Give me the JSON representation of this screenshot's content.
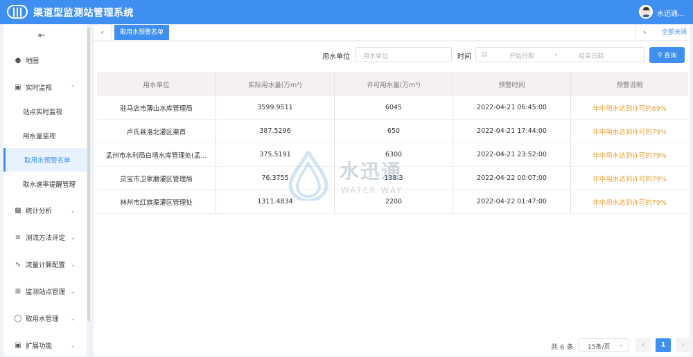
{
  "app": {
    "title": "渠道型监测站管理系统",
    "user_name": "水迅通..."
  },
  "sidebar": {
    "collapse_icon": "menu-fold-icon",
    "items": [
      {
        "label": "地图",
        "icon": "location-icon",
        "expanded": null
      },
      {
        "label": "实时监视",
        "icon": "briefcase-icon",
        "expanded": true
      },
      {
        "label": "统计分析",
        "icon": "bar-chart-icon",
        "expanded": false
      },
      {
        "label": "测流方法评定",
        "icon": "list-icon",
        "expanded": false
      },
      {
        "label": "流量计算配置",
        "icon": "pulse-icon",
        "expanded": false
      },
      {
        "label": "监测站点管理",
        "icon": "grid-icon",
        "expanded": false
      },
      {
        "label": "取用水管理",
        "icon": "drop-icon",
        "expanded": false
      },
      {
        "label": "扩展功能",
        "icon": "expand-icon",
        "expanded": false
      }
    ],
    "subitems": [
      {
        "label": "站点实时监视",
        "active": false
      },
      {
        "label": "用水量监视",
        "active": false
      },
      {
        "label": "取用水预警名单",
        "active": true
      },
      {
        "label": "取水速率提醒管理",
        "active": false
      }
    ]
  },
  "tabs": {
    "active_label": "取用水预警名单",
    "close_all_label": "全部关闭"
  },
  "filters": {
    "unit_label": "用水单位",
    "unit_placeholder": "用水单位",
    "time_label": "时间",
    "start_placeholder": "开始日期",
    "range_separator": "-",
    "end_placeholder": "结束日期",
    "search_label": "查询"
  },
  "table": {
    "headers": [
      "用水单位",
      "实际用水量(万m³)",
      "许可用水量(万m³)",
      "预警时间",
      "预警说明"
    ],
    "rows": [
      [
        "驻马店市薄山水库管理局",
        "3599.9511",
        "6045",
        "2022-04-21 06:45:00",
        "年中用水达到许可的69%"
      ],
      [
        "卢氏县洛北灌区渠首",
        "387.5296",
        "650",
        "2022-04-21 17:44:00",
        "年中用水达到许可的79%"
      ],
      [
        "孟州市水利局白墙水库管理处(孟...",
        "375.5191",
        "6300",
        "2022-04-21 23:52:00",
        "年中用水达到许可的79%"
      ],
      [
        "灵宝市卫家磨灌区管理局",
        "76.3755",
        "138.3",
        "2022-04-22 00:07:00",
        "年中用水达到许可的79%"
      ],
      [
        "林州市红旗渠灌区管理处",
        "1311.4834",
        "2200",
        "2022-04-22 01:47:00",
        "年中用水达到许可的79%"
      ]
    ]
  },
  "watermark": {
    "cn": "水迅通",
    "en": "WATER WAY"
  },
  "pagination": {
    "total_text": "共 6 条",
    "page_size": "15条/页",
    "current_page": "1"
  },
  "colors": {
    "primary": "#3f8ff0",
    "warning_text": "#e6a23c",
    "header_bg": "#f7f0f3"
  }
}
